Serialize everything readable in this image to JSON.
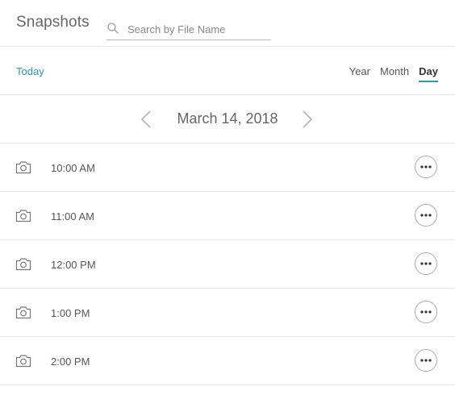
{
  "header": {
    "title": "Snapshots",
    "search": {
      "placeholder": "Search by File Name",
      "value": ""
    }
  },
  "nav": {
    "today_label": "Today",
    "views": [
      {
        "label": "Year",
        "active": false
      },
      {
        "label": "Month",
        "active": false
      },
      {
        "label": "Day",
        "active": true
      }
    ]
  },
  "date": {
    "label": "March 14, 2018"
  },
  "snapshots": [
    {
      "time": "10:00 AM",
      "icon": "camera-icon"
    },
    {
      "time": "11:00 AM",
      "icon": "camera-icon"
    },
    {
      "time": "12:00 PM",
      "icon": "camera-icon"
    },
    {
      "time": "1:00 PM",
      "icon": "camera-icon"
    },
    {
      "time": "2:00 PM",
      "icon": "camera-icon"
    }
  ],
  "colors": {
    "accent": "#2a9aa5",
    "divider": "#e8e8e8"
  }
}
